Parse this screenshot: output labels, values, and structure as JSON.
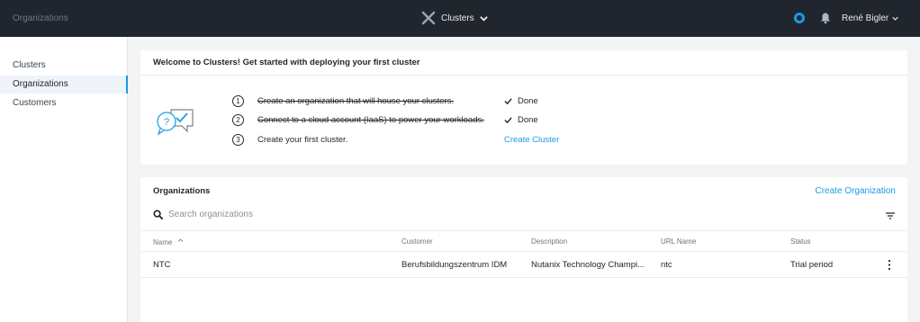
{
  "topbar": {
    "left_title": "Organizations",
    "app_title": "Clusters",
    "user_name": "René Bigler"
  },
  "sidebar": {
    "items": [
      {
        "label": "Clusters"
      },
      {
        "label": "Organizations"
      },
      {
        "label": "Customers"
      }
    ],
    "active_item": "Organizations"
  },
  "welcome": {
    "title": "Welcome to Clusters! Get started with deploying your first cluster",
    "steps": [
      {
        "number": "1",
        "text": "Create an organization that will house your clusters.",
        "status": "Done"
      },
      {
        "number": "2",
        "text": "Connect to a cloud account (IaaS) to power your workloads.",
        "status": "Done"
      },
      {
        "number": "3",
        "text": "Create your first cluster.",
        "action": "Create Cluster"
      }
    ]
  },
  "organizations": {
    "title": "Organizations",
    "create_label": "Create Organization",
    "search_placeholder": "Search organizations",
    "columns": [
      "Name",
      "Customer",
      "Description",
      "URL Name",
      "Status"
    ],
    "rows": [
      {
        "name": "NTC",
        "customer": "Berufsbildungszentrum IDM",
        "description": "Nutanix Technology Champi...",
        "url_name": "ntc",
        "status": "Trial period"
      }
    ]
  },
  "colors": {
    "accent": "#1b9ae6",
    "topbar_bg": "#21262e",
    "page_bg": "#f2f4f6"
  },
  "icons": {
    "app_logo": "x-logo-icon",
    "chevron": "chevron-down-icon",
    "status": "status-ring-icon",
    "notifications": "bell-icon",
    "search": "search-icon",
    "filter": "filter-icon",
    "done": "check-icon",
    "sort": "sort-up-icon",
    "row_menu": "kebab-menu-icon",
    "illustration": "chat-question-check-icon"
  }
}
